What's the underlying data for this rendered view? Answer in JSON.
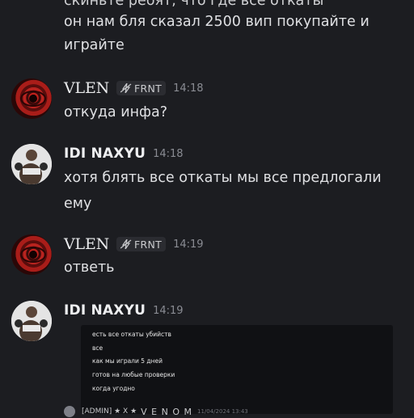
{
  "chat": {
    "cut_line_top": "скиньте ребят, что где все откаты",
    "cut_line_2": "он нам бля сказал 2500 вип покупайте и",
    "cut_line_3": "играйте",
    "messages": [
      {
        "author": "VLEN",
        "tag": "FRNT",
        "time": "14:18",
        "lines": [
          "откуда инфа?"
        ]
      },
      {
        "author": "IDI NAXYU",
        "time": "14:18",
        "lines": [
          "хотя блять все откаты мы все предлогали",
          "ему"
        ]
      },
      {
        "author": "VLEN",
        "tag": "FRNT",
        "time": "14:19",
        "lines": [
          "ответь"
        ]
      },
      {
        "author": "IDI NAXYU",
        "time": "14:19",
        "attachment_lines": [
          "есть все откаты убийств",
          "все",
          "как мы играли 5 дней",
          "готов на любые проверки",
          "когда угодно"
        ]
      }
    ],
    "reply_preview": {
      "name": "[ADMIN] ★ X ★",
      "name2": "V E N O M",
      "time": "11/04/2024 13:43"
    }
  },
  "colors": {
    "background": "#1c1d21",
    "text": "#dfe0e3",
    "muted": "#8a8c93",
    "tag_bg": "#2b2c31"
  },
  "icons": {
    "tag_icon": "lightning-slash-icon"
  }
}
